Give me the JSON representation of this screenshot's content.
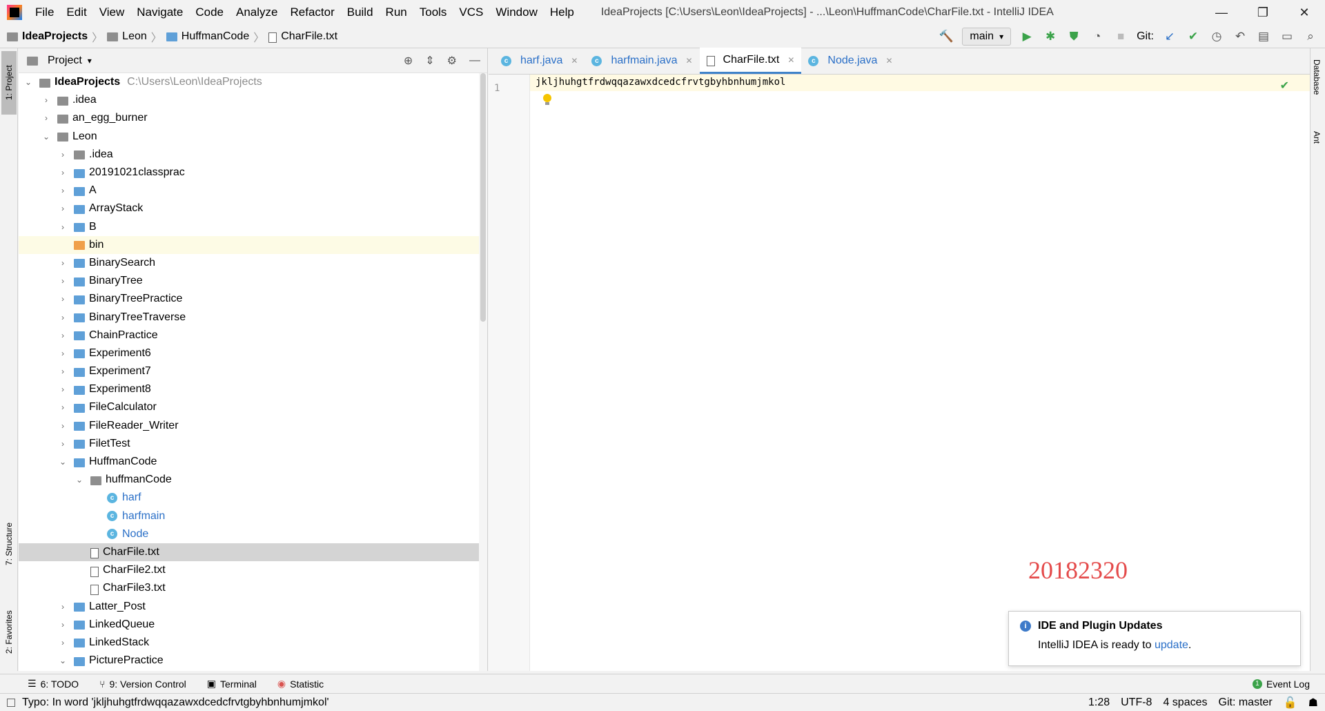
{
  "window": {
    "title": "IdeaProjects [C:\\Users\\Leon\\IdeaProjects] - ...\\Leon\\HuffmanCode\\CharFile.txt - IntelliJ IDEA",
    "minimize": "—",
    "maximize": "❐",
    "close": "✕"
  },
  "menu": [
    "File",
    "Edit",
    "View",
    "Navigate",
    "Code",
    "Analyze",
    "Refactor",
    "Build",
    "Run",
    "Tools",
    "VCS",
    "Window",
    "Help"
  ],
  "breadcrumb": [
    "IdeaProjects",
    "Leon",
    "HuffmanCode",
    "CharFile.txt"
  ],
  "toolbar": {
    "branch": "main",
    "git_label": "Git:"
  },
  "project_panel": {
    "title": "Project",
    "root_name": "IdeaProjects",
    "root_path": "C:\\Users\\Leon\\IdeaProjects",
    "items": [
      {
        "name": ".idea",
        "depth": 1,
        "arrow": "›",
        "kind": "folder-gray"
      },
      {
        "name": "an_egg_burner",
        "depth": 1,
        "arrow": "›",
        "kind": "folder-gray"
      },
      {
        "name": "Leon",
        "depth": 1,
        "arrow": "⌄",
        "kind": "folder-gray"
      },
      {
        "name": ".idea",
        "depth": 2,
        "arrow": "›",
        "kind": "folder-gray"
      },
      {
        "name": "20191021classprac",
        "depth": 2,
        "arrow": "›",
        "kind": "folder"
      },
      {
        "name": "A",
        "depth": 2,
        "arrow": "›",
        "kind": "folder"
      },
      {
        "name": "ArrayStack",
        "depth": 2,
        "arrow": "›",
        "kind": "folder"
      },
      {
        "name": "B",
        "depth": 2,
        "arrow": "›",
        "kind": "folder"
      },
      {
        "name": "bin",
        "depth": 2,
        "arrow": "",
        "kind": "folder-orange",
        "state": "highlight"
      },
      {
        "name": "BinarySearch",
        "depth": 2,
        "arrow": "›",
        "kind": "folder"
      },
      {
        "name": "BinaryTree",
        "depth": 2,
        "arrow": "›",
        "kind": "folder"
      },
      {
        "name": "BinaryTreePractice",
        "depth": 2,
        "arrow": "›",
        "kind": "folder"
      },
      {
        "name": "BinaryTreeTraverse",
        "depth": 2,
        "arrow": "›",
        "kind": "folder"
      },
      {
        "name": "ChainPractice",
        "depth": 2,
        "arrow": "›",
        "kind": "folder"
      },
      {
        "name": "Experiment6",
        "depth": 2,
        "arrow": "›",
        "kind": "folder"
      },
      {
        "name": "Experiment7",
        "depth": 2,
        "arrow": "›",
        "kind": "folder"
      },
      {
        "name": "Experiment8",
        "depth": 2,
        "arrow": "›",
        "kind": "folder"
      },
      {
        "name": "FileCalculator",
        "depth": 2,
        "arrow": "›",
        "kind": "folder"
      },
      {
        "name": "FileReader_Writer",
        "depth": 2,
        "arrow": "›",
        "kind": "folder"
      },
      {
        "name": "FiletTest",
        "depth": 2,
        "arrow": "›",
        "kind": "folder"
      },
      {
        "name": "HuffmanCode",
        "depth": 2,
        "arrow": "⌄",
        "kind": "folder"
      },
      {
        "name": "huffmanCode",
        "depth": 3,
        "arrow": "⌄",
        "kind": "folder-gray"
      },
      {
        "name": "harf",
        "depth": 4,
        "arrow": "",
        "kind": "java"
      },
      {
        "name": "harfmain",
        "depth": 4,
        "arrow": "",
        "kind": "java"
      },
      {
        "name": "Node",
        "depth": 4,
        "arrow": "",
        "kind": "java"
      },
      {
        "name": "CharFile.txt",
        "depth": 3,
        "arrow": "",
        "kind": "txt",
        "state": "selected"
      },
      {
        "name": "CharFile2.txt",
        "depth": 3,
        "arrow": "",
        "kind": "txt"
      },
      {
        "name": "CharFile3.txt",
        "depth": 3,
        "arrow": "",
        "kind": "txt"
      },
      {
        "name": "Latter_Post",
        "depth": 2,
        "arrow": "›",
        "kind": "folder"
      },
      {
        "name": "LinkedQueue",
        "depth": 2,
        "arrow": "›",
        "kind": "folder"
      },
      {
        "name": "LinkedStack",
        "depth": 2,
        "arrow": "›",
        "kind": "folder"
      },
      {
        "name": "PicturePractice",
        "depth": 2,
        "arrow": "⌄",
        "kind": "folder"
      }
    ]
  },
  "editor": {
    "tabs": [
      {
        "label": "harf.java",
        "kind": "java"
      },
      {
        "label": "harfmain.java",
        "kind": "java"
      },
      {
        "label": "CharFile.txt",
        "kind": "txt",
        "active": true
      },
      {
        "label": "Node.java",
        "kind": "java"
      }
    ],
    "line_number": "1",
    "code": "jkljhuhgtfrdwqqazawxdcedcfrvtgbyhbnhumjmkol",
    "watermark": "20182320"
  },
  "left_stripe": [
    "1: Project",
    "7: Structure",
    "2: Favorites"
  ],
  "right_stripe": [
    "Database",
    "Ant"
  ],
  "notification": {
    "title": "IDE and Plugin Updates",
    "body": "IntelliJ IDEA is ready to",
    "link": "update",
    "suffix": "."
  },
  "bottom_tools": [
    "6: TODO",
    "9: Version Control",
    "Terminal",
    "Statistic"
  ],
  "event_log": "Event Log",
  "status": {
    "message": "Typo: In word 'jkljhuhgtfrdwqqazawxdcedcfrvtgbyhbnhumjmkol'",
    "position": "1:28",
    "encoding": "UTF-8",
    "indent": "4 spaces",
    "vcs": "Git: master"
  }
}
